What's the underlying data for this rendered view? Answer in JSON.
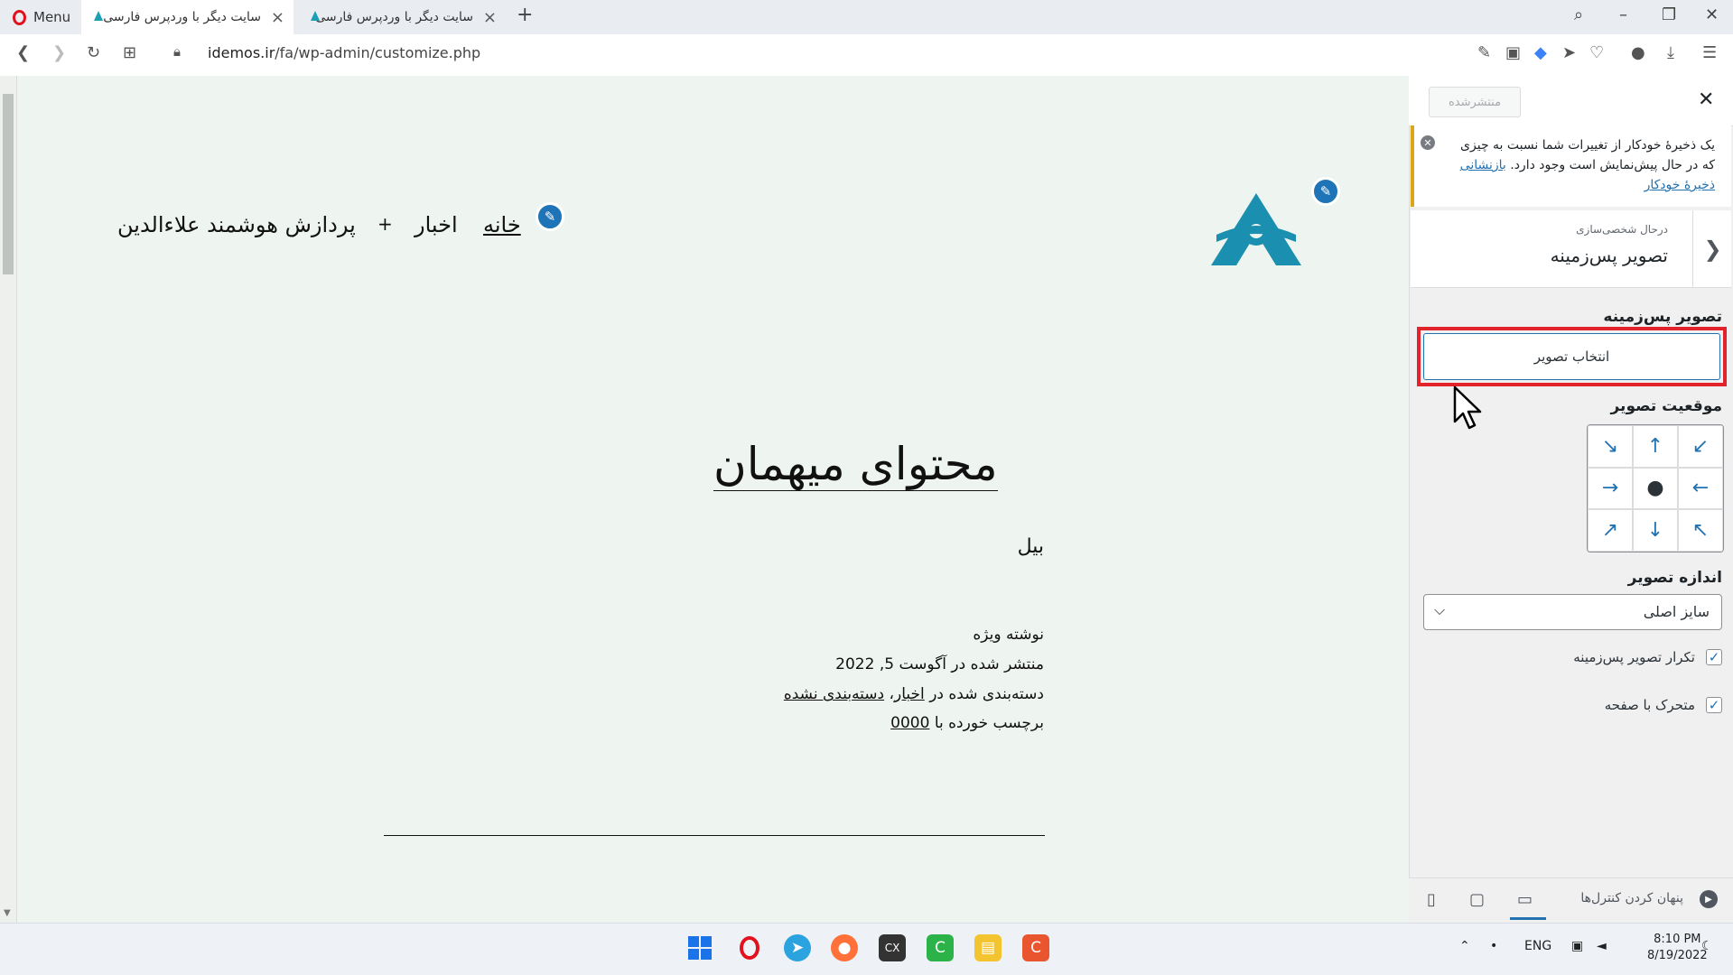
{
  "browser": {
    "menu_label": "Menu",
    "tabs": [
      {
        "title": "سایت دیگر با وردپرس فارسی",
        "active": true
      },
      {
        "title": "سایت دیگر با وردپرس فارسی",
        "active": false
      }
    ],
    "url_host": "idemos.ir",
    "url_path": "/fa/wp-admin/customize.php"
  },
  "site": {
    "nav": {
      "home": "خانه",
      "news": "اخبار",
      "plus": "+",
      "site_name": "پردازش هوشمند علاءالدین"
    },
    "post": {
      "title": "محتوای میهمان",
      "author": "بیل",
      "sticky": "نوشته ویژه",
      "published": "منتشر شده در آگوست 5, 2022",
      "categories_prefix": "دسته‌بندی شده در",
      "category_1": "اخبار",
      "category_2": "دسته‌بندی نشده",
      "tags_prefix": "برچسب خورده با",
      "tag": "0000"
    }
  },
  "customizer": {
    "publish_label": "منتشرشده",
    "notice_text": "یک ذخیرهٔ خودکار از تغییرات شما نسبت به چیزی که در حال پیش‌نمایش است وجود دارد.",
    "notice_link": "بازنشانی ذخیرهٔ خودکار",
    "customizing_label": "درحال شخصی‌سازی",
    "section_title": "تصویر پس‌زمینه",
    "bg_image_title": "تصویر پس‌زمینه",
    "select_image_label": "انتخاب تصویر",
    "position_title": "موقعیت تصویر",
    "size_title": "اندازه تصویر",
    "size_value": "سایز اصلی",
    "repeat_label": "تکرار تصویر پس‌زمینه",
    "scroll_label": "متحرک با صفحه",
    "hide_controls_label": "پنهان کردن کنترل‌ها",
    "accent_color": "#2271b1",
    "highlight_color": "#e3232c"
  },
  "taskbar": {
    "lang": "ENG",
    "time": "8:10 PM",
    "date": "8/19/2022"
  }
}
